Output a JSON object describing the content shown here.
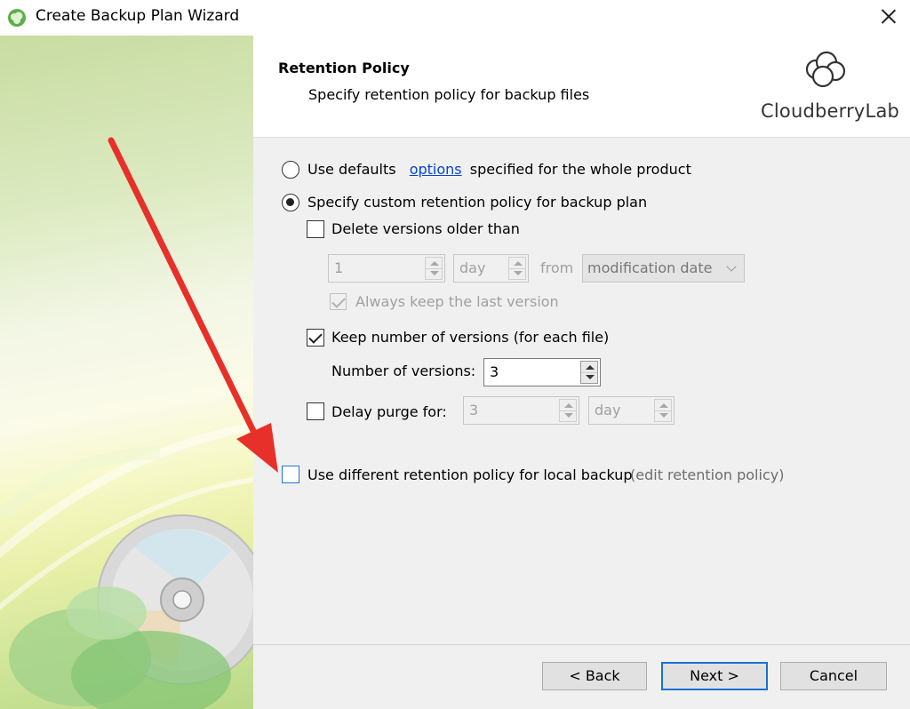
{
  "window": {
    "title": "Create Backup Plan Wizard"
  },
  "header": {
    "title": "Retention Policy",
    "subtitle": "Specify retention policy for backup files",
    "logo_text": "CloudberryLab"
  },
  "policy": {
    "use_defaults_label": "Use defaults",
    "options_link": "options",
    "use_defaults_suffix": "specified for the whole product",
    "use_defaults_selected": false,
    "custom_label": "Specify custom retention policy for backup plan",
    "custom_selected": true,
    "delete_versions": {
      "label": "Delete versions older than",
      "checked": false,
      "value": "1",
      "unit": "day",
      "from_label": "from",
      "from_value": "modification date",
      "keep_last_label": "Always keep the last version",
      "keep_last_checked": true
    },
    "keep_versions": {
      "label": "Keep number of versions (for each file)",
      "checked": true,
      "count_label": "Number of versions:",
      "count_value": "3"
    },
    "delay_purge": {
      "label": "Delay purge for:",
      "checked": false,
      "value": "3",
      "unit": "day"
    },
    "local_backup": {
      "label": "Use different retention policy for local backup",
      "checked": false,
      "edit_label": "(edit retention policy)"
    }
  },
  "buttons": {
    "back": "< Back",
    "next": "Next >",
    "cancel": "Cancel"
  },
  "colors": {
    "annotation_arrow": "#e8302a",
    "link": "#0645d2",
    "default_button_border": "#1a70d0"
  }
}
